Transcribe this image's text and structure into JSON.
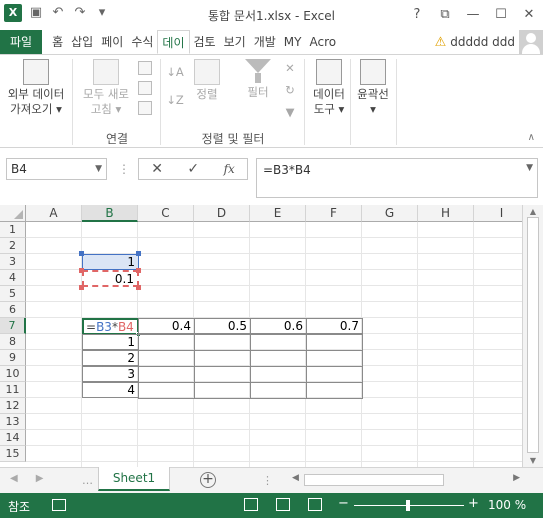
{
  "window": {
    "title": "통합 문서1.xlsx - Excel",
    "controls": [
      "?",
      "⧉",
      "—",
      "☐",
      "✕"
    ]
  },
  "qat": {
    "logo": "X"
  },
  "tabs": {
    "file": "파일",
    "items": [
      "홈",
      "삽입",
      "페이",
      "수식",
      "데이",
      "검토",
      "보기",
      "개발",
      "MY",
      "Acro"
    ],
    "active_index": 4
  },
  "user": {
    "name": "ddddd ddd"
  },
  "ribbon": {
    "ext_data": {
      "line1": "외부 데이터",
      "line2": "가져오기"
    },
    "connections": {
      "refresh_line1": "모두 새로",
      "refresh_line2": "고침",
      "group_label": "연결"
    },
    "sort_filter": {
      "sort": "정렬",
      "filter": "필터",
      "group_label": "정렬 및 필터"
    },
    "data_tools": {
      "line1": "데이터",
      "line2": "도구"
    },
    "outline": {
      "label": "윤곽선"
    }
  },
  "formula_bar": {
    "name_box": "B4",
    "formula": "=B3*B4",
    "fx": "fx"
  },
  "sheet": {
    "columns": [
      "A",
      "B",
      "C",
      "D",
      "E",
      "F",
      "G",
      "H",
      "I"
    ],
    "selected_column": "B",
    "rows": [
      "1",
      "2",
      "3",
      "4",
      "5",
      "6",
      "7",
      "8",
      "9",
      "10",
      "11",
      "12",
      "13",
      "14",
      "15"
    ],
    "selected_row": "7",
    "cells": {
      "B3": "1",
      "B4": "0.1",
      "B7_ref1": "B3",
      "B7_ref2": "B4",
      "C7": "0.4",
      "D7": "0.5",
      "E7": "0.6",
      "F7": "0.7",
      "B8": "1",
      "B9": "2",
      "B10": "3",
      "B11": "4"
    }
  },
  "sheet_tabs": {
    "active": "Sheet1"
  },
  "status": {
    "mode": "참조",
    "zoom": "100 %"
  },
  "colors": {
    "accent": "#217346",
    "ref_blue": "#4472c4",
    "ref_red": "#e06666"
  }
}
